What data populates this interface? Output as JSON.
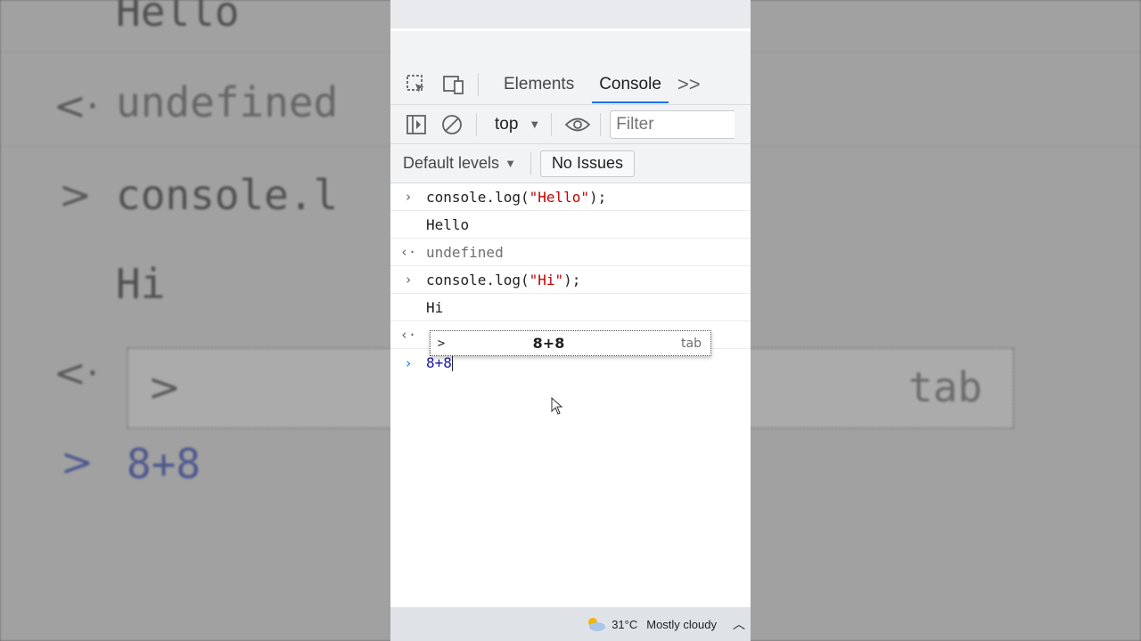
{
  "background": {
    "line1": "Hello",
    "line2": "undefined",
    "line3": "console.l",
    "line4": "Hi",
    "line5": "8+8",
    "tab_hint": "tab"
  },
  "tabs": {
    "elements": "Elements",
    "console": "Console",
    "more": ">>"
  },
  "toolbar": {
    "context": "top",
    "filter_placeholder": "Filter"
  },
  "levels": {
    "default_levels": "Default levels",
    "no_issues": "No Issues"
  },
  "console": {
    "entries": [
      {
        "kind": "input",
        "pre": "console.log(",
        "str": "\"Hello\"",
        "post": ");"
      },
      {
        "kind": "output",
        "text": "Hello"
      },
      {
        "kind": "return",
        "text": "undefined"
      },
      {
        "kind": "input",
        "pre": "console.log(",
        "str": "\"Hi\"",
        "post": ");"
      },
      {
        "kind": "output",
        "text": "Hi"
      }
    ],
    "current_input": "8+8",
    "suggestion": {
      "value": "8+8",
      "hint": "tab"
    }
  },
  "taskbar": {
    "temperature": "31°C",
    "condition": "Mostly cloudy"
  },
  "colors": {
    "accent": "#1a73e8",
    "string": "#c80000"
  }
}
